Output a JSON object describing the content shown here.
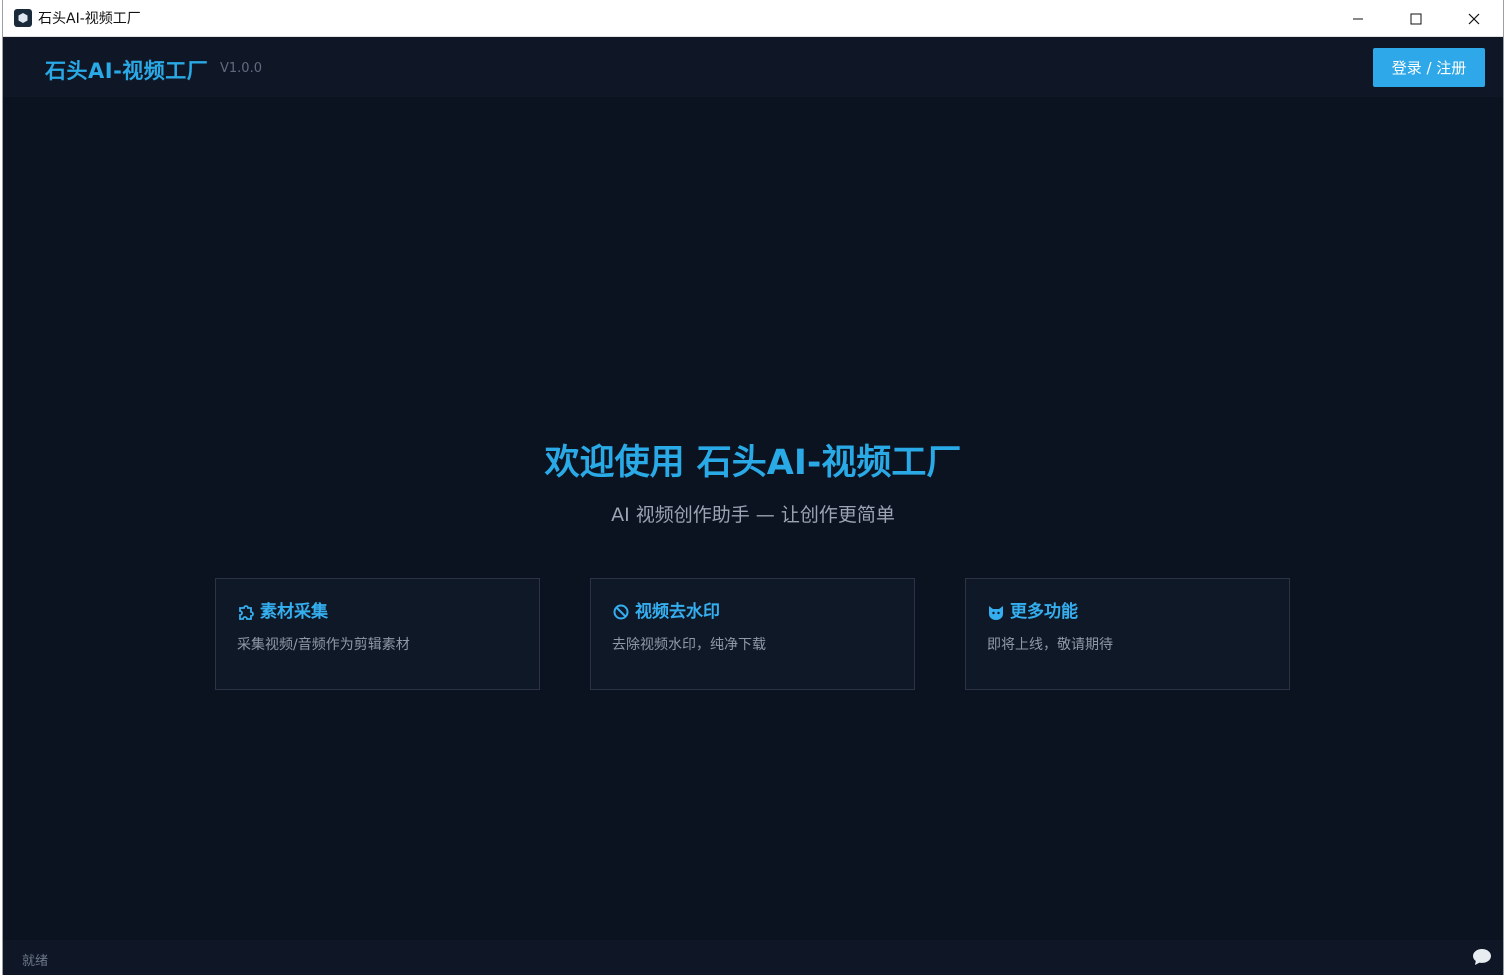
{
  "window": {
    "title": "石头AI-视频工厂"
  },
  "header": {
    "brand": "石头AI-视频工厂",
    "version": "V1.0.0",
    "login_label": "登录 / 注册"
  },
  "main": {
    "welcome": "欢迎使用 石头AI-视频工厂",
    "subtitle": "AI 视频创作助手 — 让创作更简单",
    "cards": [
      {
        "title": "素材采集",
        "desc": "采集视频/音频作为剪辑素材",
        "icon": "puzzle-icon"
      },
      {
        "title": "视频去水印",
        "desc": "去除视频水印，纯净下载",
        "icon": "ban-icon"
      },
      {
        "title": "更多功能",
        "desc": "即将上线，敬请期待",
        "icon": "cat-icon"
      }
    ]
  },
  "status": {
    "text": "就绪"
  },
  "colors": {
    "accent": "#29a9e6",
    "background": "#0b1220",
    "panel": "#0f1726",
    "button": "#2ea8e8"
  }
}
